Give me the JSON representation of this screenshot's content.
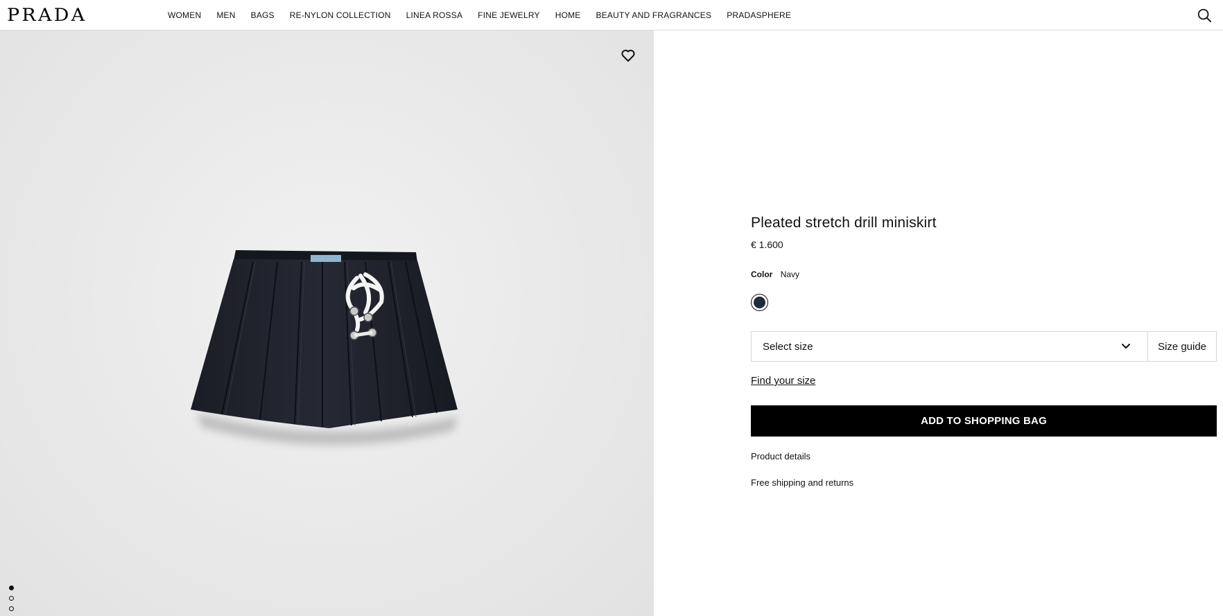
{
  "brand": {
    "logo_text": "PRADA"
  },
  "nav": {
    "items": [
      {
        "label": "WOMEN"
      },
      {
        "label": "MEN"
      },
      {
        "label": "BAGS"
      },
      {
        "label": "RE-NYLON COLLECTION"
      },
      {
        "label": "LINEA ROSSA"
      },
      {
        "label": "FINE JEWELRY"
      },
      {
        "label": "HOME"
      },
      {
        "label": "BEAUTY AND FRAGRANCES"
      },
      {
        "label": "PRADASPHERE"
      }
    ],
    "search_icon": "search-icon"
  },
  "gallery": {
    "wishlist_icon": "heart-icon",
    "image_count": 3,
    "active_index": 0,
    "background_color": "#e9e9e9"
  },
  "product": {
    "title": "Pleated stretch drill miniskirt",
    "price": "€ 1.600",
    "color_label": "Color",
    "color_value": "Navy",
    "swatch_color": "#1f2a3c",
    "size_select_label": "Select size",
    "size_guide_label": "Size guide",
    "find_size_label": "Find your size",
    "add_to_bag_label": "ADD TO SHOPPING BAG",
    "details_label": "Product details",
    "shipping_label": "Free shipping and returns"
  },
  "colors": {
    "accent": "#000000",
    "button_text": "#ffffff",
    "border": "#d6d6d6"
  }
}
